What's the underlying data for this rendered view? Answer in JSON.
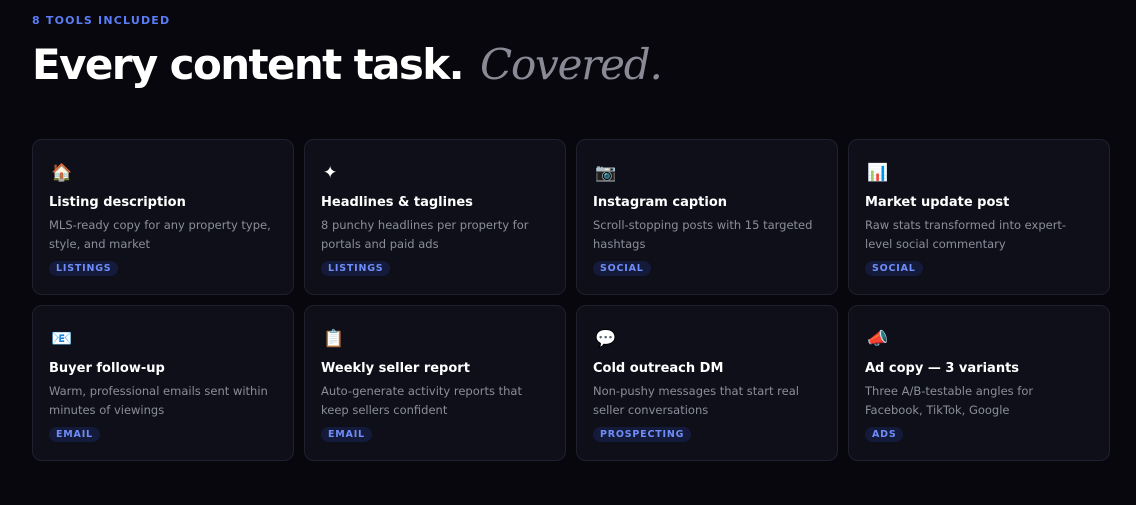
{
  "header": {
    "eyebrow": "8 TOOLS INCLUDED",
    "title_main": "Every content task.",
    "title_accent": "Covered."
  },
  "tools": [
    {
      "icon": "house-icon",
      "glyph": "🏠",
      "title": "Listing description",
      "description": "MLS-ready copy for any property type, style, and market",
      "tag": "LISTINGS"
    },
    {
      "icon": "sparkle-icon",
      "glyph": "✦",
      "title": "Headlines & taglines",
      "description": "8 punchy headlines per property for portals and paid ads",
      "tag": "LISTINGS"
    },
    {
      "icon": "camera-icon",
      "glyph": "📷",
      "title": "Instagram caption",
      "description": "Scroll-stopping posts with 15 targeted hashtags",
      "tag": "SOCIAL"
    },
    {
      "icon": "bar-chart-icon",
      "glyph": "📊",
      "title": "Market update post",
      "description": "Raw stats transformed into expert-level social commentary",
      "tag": "SOCIAL"
    },
    {
      "icon": "email-icon",
      "glyph": "📧",
      "title": "Buyer follow-up",
      "description": "Warm, professional emails sent within minutes of viewings",
      "tag": "EMAIL"
    },
    {
      "icon": "clipboard-icon",
      "glyph": "📋",
      "title": "Weekly seller report",
      "description": "Auto-generate activity reports that keep sellers confident",
      "tag": "EMAIL"
    },
    {
      "icon": "speech-bubble-icon",
      "glyph": "💬",
      "title": "Cold outreach DM",
      "description": "Non-pushy messages that start real seller conversations",
      "tag": "PROSPECTING"
    },
    {
      "icon": "megaphone-icon",
      "glyph": "📣",
      "title": "Ad copy — 3 variants",
      "description": "Three A/B-testable angles for Facebook, TikTok, Google",
      "tag": "ADS"
    }
  ]
}
